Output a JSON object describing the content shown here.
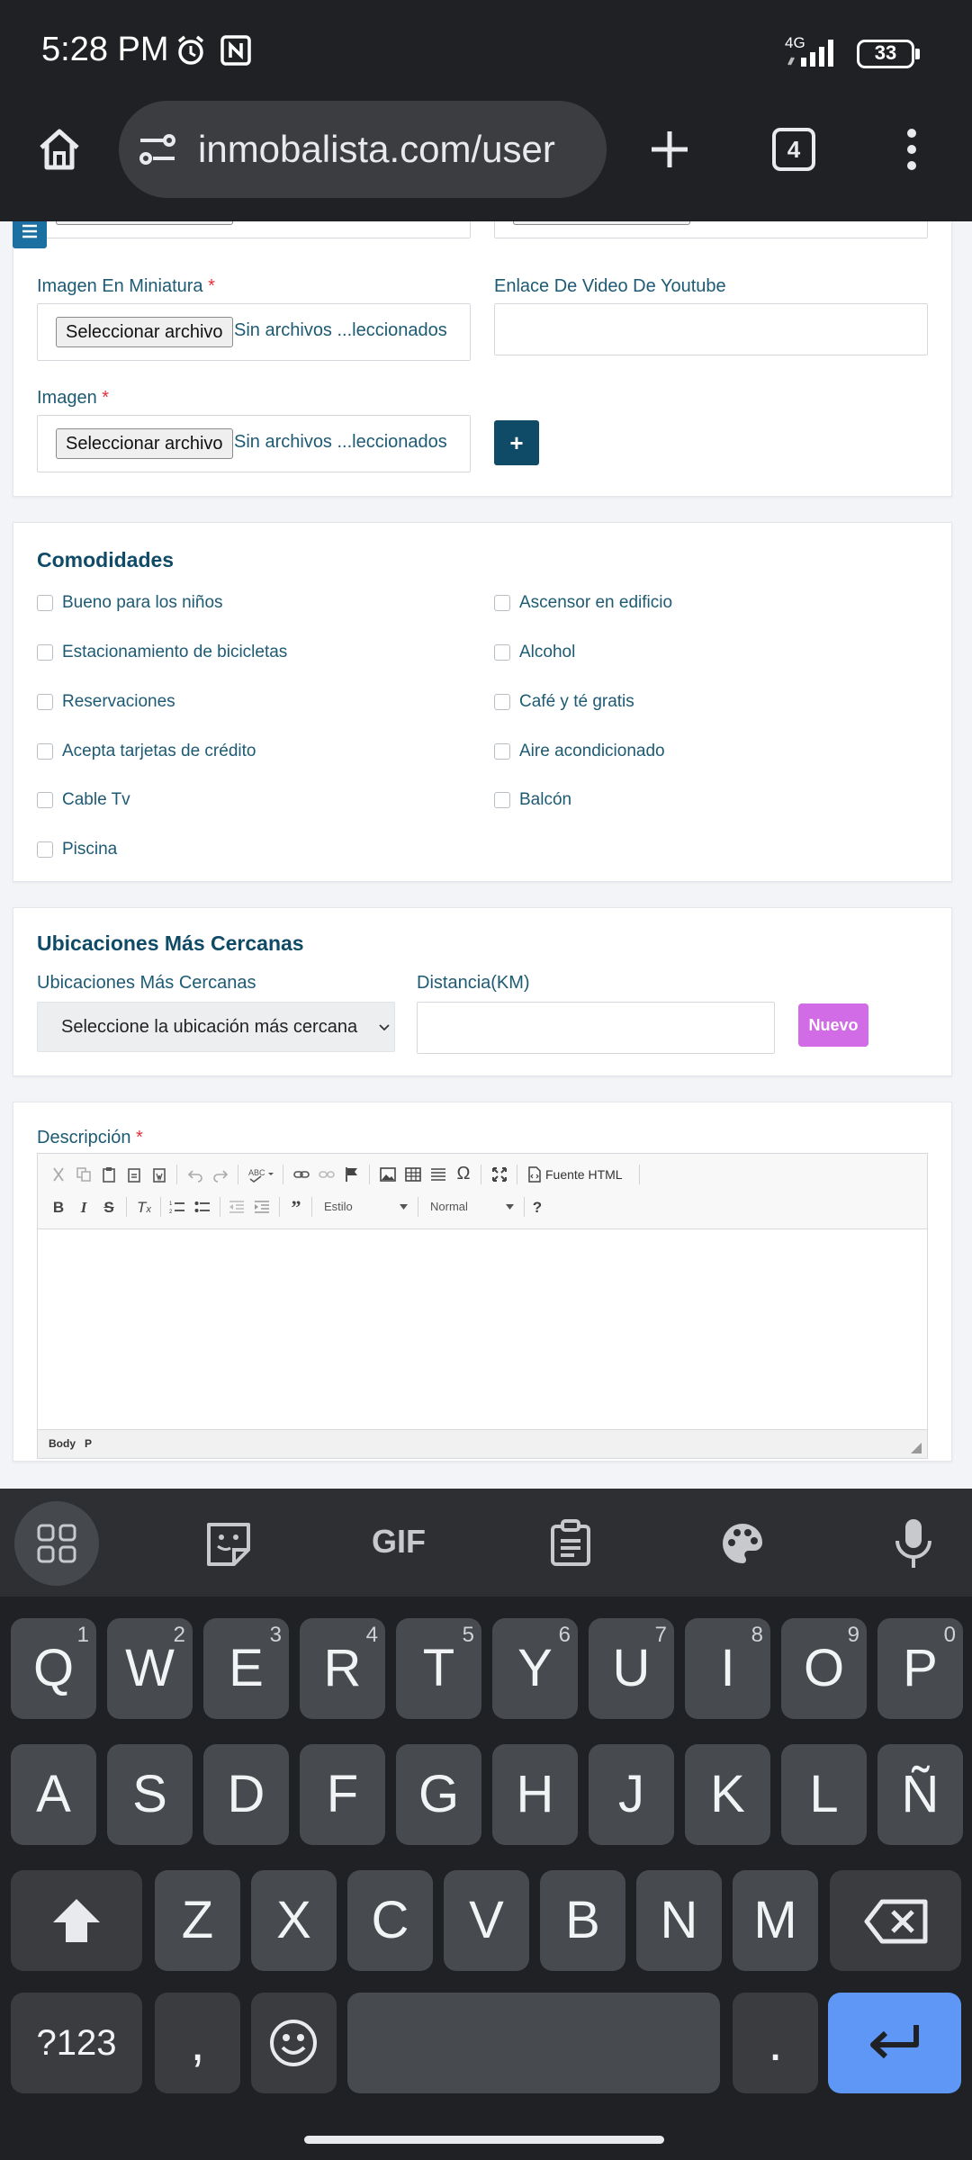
{
  "status_bar": {
    "time": "5:28 PM",
    "network": "4G",
    "battery": "33"
  },
  "browser": {
    "url": "inmobalista.com/user",
    "tab_count": "4"
  },
  "form_top": {
    "file_button_label": "Seleccionar archivo",
    "file_status": "Sin archivos ...leccionados",
    "thumbnail_label": "Imagen En Miniatura",
    "youtube_label": "Enlace De Video De Youtube",
    "image_label": "Imagen",
    "required_mark": "*",
    "add_button": "+"
  },
  "amenities": {
    "title": "Comodidades",
    "items": [
      "Bueno para los niños",
      "Ascensor en edificio",
      "Estacionamiento de bicicletas",
      "Alcohol",
      "Reservaciones",
      "Café y té gratis",
      "Acepta tarjetas de crédito",
      "Aire acondicionado",
      "Cable Tv",
      "Balcón",
      "Piscina"
    ]
  },
  "nearby": {
    "title": "Ubicaciones Más Cercanas",
    "location_label": "Ubicaciones Más Cercanas",
    "distance_label": "Distancia(KM)",
    "select_value": "Seleccione la ubicación más cercana",
    "new_button": "Nuevo"
  },
  "description": {
    "label": "Descripción",
    "source_button": "Fuente HTML",
    "style_dropdown": "Estilo",
    "format_dropdown": "Normal",
    "path_body": "Body",
    "path_p": "P",
    "help": "?"
  },
  "keyboard": {
    "row1": [
      {
        "k": "Q",
        "s": "1"
      },
      {
        "k": "W",
        "s": "2"
      },
      {
        "k": "E",
        "s": "3"
      },
      {
        "k": "R",
        "s": "4"
      },
      {
        "k": "T",
        "s": "5"
      },
      {
        "k": "Y",
        "s": "6"
      },
      {
        "k": "U",
        "s": "7"
      },
      {
        "k": "I",
        "s": "8"
      },
      {
        "k": "O",
        "s": "9"
      },
      {
        "k": "P",
        "s": "0"
      }
    ],
    "row2": [
      "A",
      "S",
      "D",
      "F",
      "G",
      "H",
      "J",
      "K",
      "L",
      "Ñ"
    ],
    "row3": [
      "Z",
      "X",
      "C",
      "V",
      "B",
      "N",
      "M"
    ],
    "symbols": "?123",
    "comma": ",",
    "period": ".",
    "gif": "GIF"
  },
  "colors": {
    "primary": "#0f4a66",
    "new_button": "#d16be6",
    "enter_key": "#5e97f6"
  }
}
